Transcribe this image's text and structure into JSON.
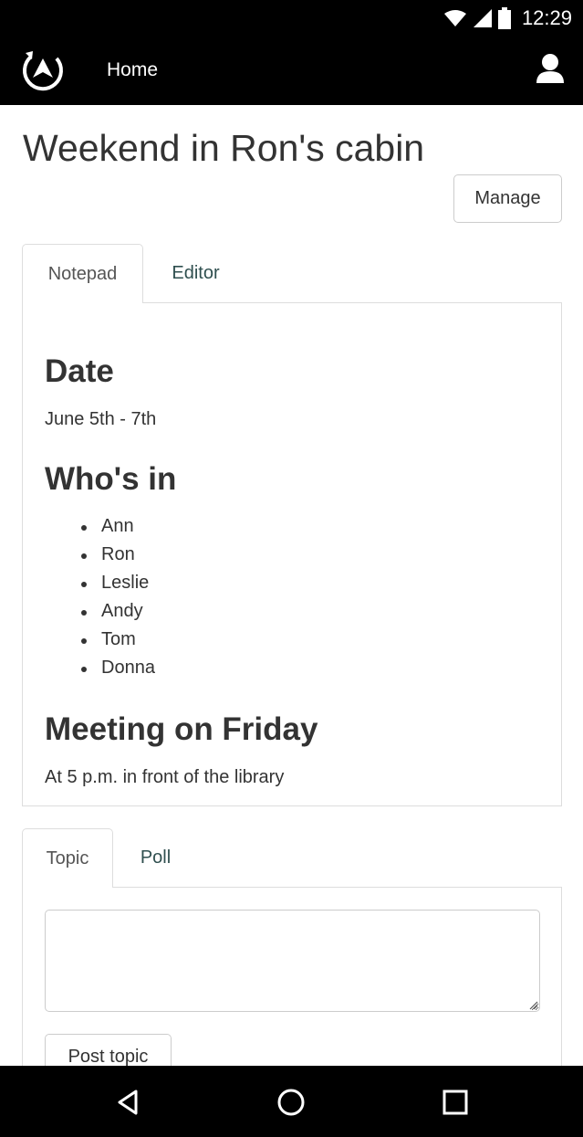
{
  "status_bar": {
    "time": "12:29",
    "icons": [
      "wifi-icon",
      "cell-signal-icon",
      "battery-icon"
    ]
  },
  "app_bar": {
    "logo_icon": "app-logo-icon",
    "title": "Home",
    "user_icon": "user-icon"
  },
  "page": {
    "title": "Weekend in Ron's cabin",
    "manage_label": "Manage"
  },
  "notepad": {
    "tabs": [
      {
        "label": "Notepad",
        "active": true
      },
      {
        "label": "Editor",
        "active": false
      }
    ],
    "date_heading": "Date",
    "date_value": "June 5th - 7th",
    "whos_in_heading": "Who's in",
    "people": [
      "Ann",
      "Ron",
      "Leslie",
      "Andy",
      "Tom",
      "Donna"
    ],
    "meeting_heading": "Meeting on Friday",
    "meeting_text": "At 5 p.m. in front of the library"
  },
  "discussion": {
    "tabs": [
      {
        "label": "Topic",
        "active": true
      },
      {
        "label": "Poll",
        "active": false
      }
    ],
    "topic_value": "",
    "post_label": "Post topic"
  },
  "nav_bar": {
    "icons": [
      "back-icon",
      "home-icon",
      "recents-icon"
    ]
  },
  "colors": {
    "bar_background": "#000000",
    "text": "#333333",
    "tab_link": "#2f4f4f",
    "border": "#dddddd"
  }
}
